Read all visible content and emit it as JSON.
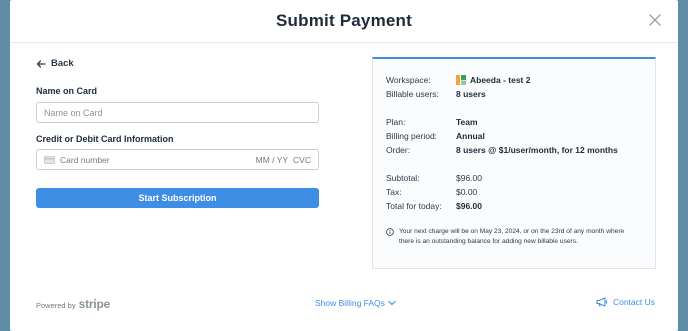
{
  "modal": {
    "title": "Submit Payment"
  },
  "form": {
    "back_label": "Back",
    "name_label": "Name on Card",
    "name_placeholder": "Name on Card",
    "card_label": "Credit or Debit Card Information",
    "card_number_placeholder": "Card number",
    "card_exp_placeholder": "MM / YY",
    "card_cvc_placeholder": "CVC",
    "submit_label": "Start Subscription"
  },
  "summary": {
    "workspace_key": "Workspace:",
    "workspace_value": "Abeeda - test 2",
    "billable_users_key": "Billable users:",
    "billable_users_value": "8 users",
    "plan_key": "Plan:",
    "plan_value": "Team",
    "billing_period_key": "Billing period:",
    "billing_period_value": "Annual",
    "order_key": "Order:",
    "order_value": "8 users @ $1/user/month, for 12 months",
    "subtotal_key": "Subtotal:",
    "subtotal_value": "$96.00",
    "tax_key": "Tax:",
    "tax_value": "$0.00",
    "total_key": "Total for today:",
    "total_value": "$96.00",
    "notice": "Your next charge will be on May 23, 2024, or on the 23rd of any month where there is an outstanding balance for adding new billable users."
  },
  "footer": {
    "powered_by": "Powered by",
    "stripe": "stripe",
    "faq_label": "Show Billing FAQs",
    "contact_label": "Contact Us"
  },
  "colors": {
    "accent": "#3e8ee6",
    "backdrop": "#5f8da6",
    "heading": "#1d2b3a"
  },
  "icons": {
    "back": "arrow-left-icon",
    "close": "close-icon",
    "card": "credit-card-icon",
    "info": "info-icon",
    "faq": "chevron-down-icon",
    "contact": "megaphone-icon",
    "workspace": "workspace-logo"
  }
}
